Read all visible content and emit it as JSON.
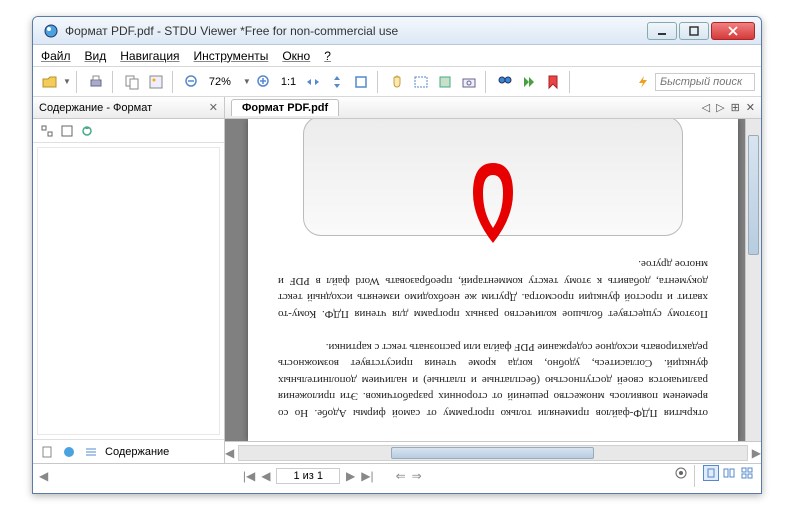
{
  "window": {
    "title": "Формат PDF.pdf - STDU Viewer *Free for non-commercial use"
  },
  "menu": {
    "file": "Файл",
    "view": "Вид",
    "navigation": "Навигация",
    "tools": "Инструменты",
    "window": "Окно",
    "help": "?"
  },
  "toolbar": {
    "zoom_value": "72%",
    "fit_ratio": "1:1",
    "search_placeholder": "Быстрый поиск"
  },
  "sidepanel": {
    "tab_label": "Содержание - Формат",
    "bottom_label": "Содержание"
  },
  "document": {
    "tab_label": "Формат PDF.pdf",
    "page_indicator": "1 из 1",
    "content_p1": "открытия ПДФ-файлов применяли только программу от самой фирмы Адобе. Но со временем появилось множество решений от сторонних разработчиков. Эти приложения различаются своей доступностью (бесплатные и платные) и наличием дополнительных функций. Согласитесь, удобно, когда кроме чтения присутствует возможность редактировать исходное содержание PDF файла или распознать текст с картинки.",
    "content_p2": "Поэтому существует большое количество разных программ для чтения ПДФ. Кому-то хватит и простой функции просмотра. Другим же необходимо изменять исходный текст документа, добавить к этому тексту комментарий, преобразовать Word файл в PDF и многое другое."
  }
}
